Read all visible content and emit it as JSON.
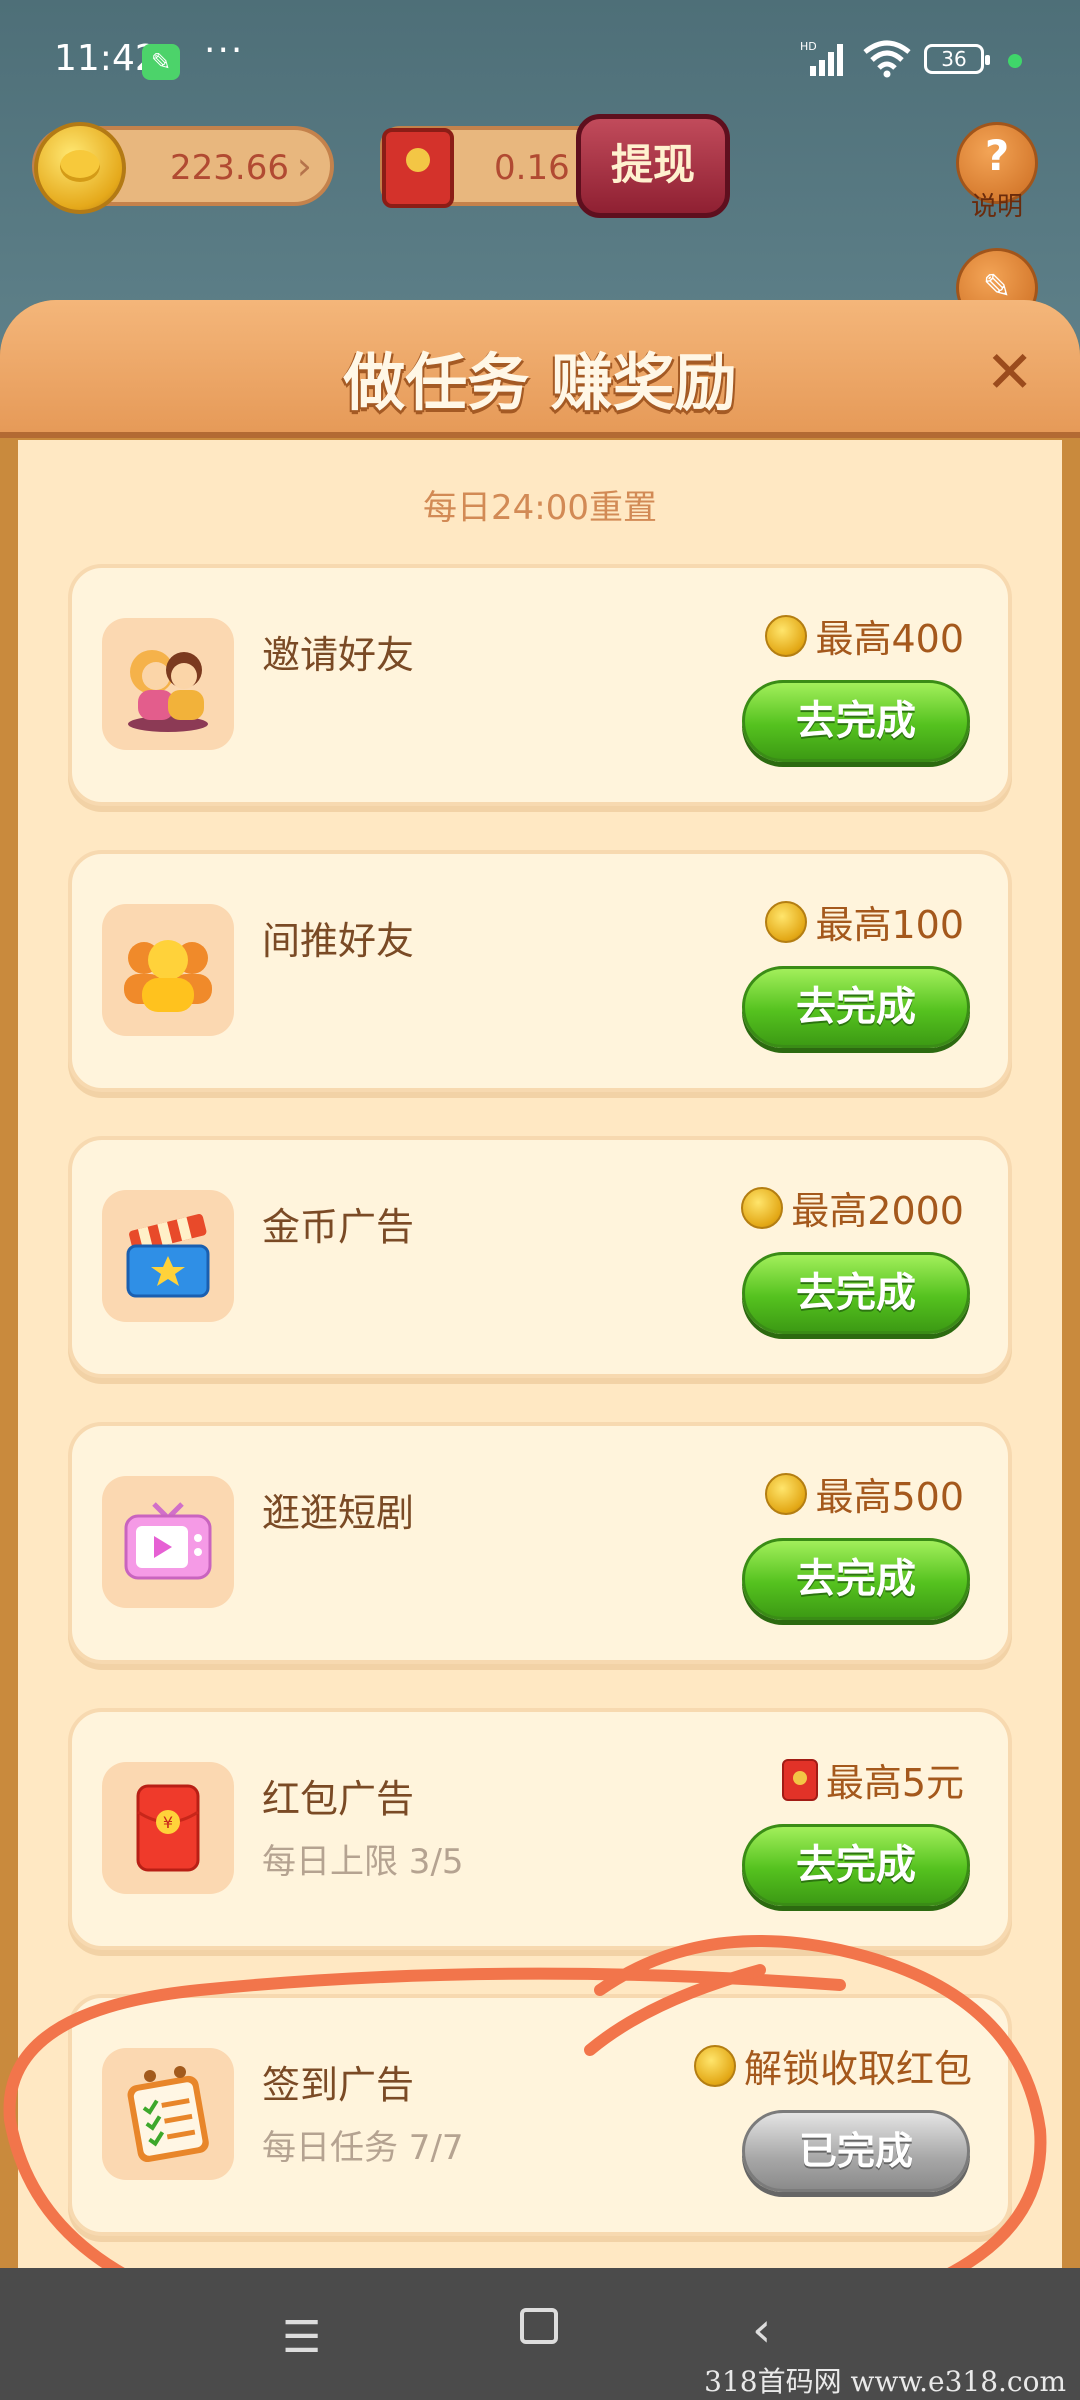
{
  "status_bar": {
    "time": "11:42",
    "more": "···",
    "battery": "36"
  },
  "top_bar": {
    "coins": "223.66",
    "cash": "0.16",
    "withdraw_label": "提现",
    "help_label": "说明"
  },
  "panel": {
    "title": "做任务 赚奖励",
    "reset_note": "每日24:00重置",
    "close": "✕"
  },
  "tasks": [
    {
      "name": "邀请好友",
      "sub": "",
      "reward": "最高400",
      "reward_type": "coin",
      "button": "去完成",
      "icon": "invite-friends-icon"
    },
    {
      "name": "间推好友",
      "sub": "",
      "reward": "最高100",
      "reward_type": "coin",
      "button": "去完成",
      "icon": "indirect-friends-icon"
    },
    {
      "name": "金币广告",
      "sub": "",
      "reward": "最高2000",
      "reward_type": "coin",
      "button": "去完成",
      "icon": "clapperboard-icon"
    },
    {
      "name": "逛逛短剧",
      "sub": "",
      "reward": "最高500",
      "reward_type": "coin",
      "button": "去完成",
      "icon": "tv-play-icon"
    },
    {
      "name": "红包广告",
      "sub": "每日上限 3/5",
      "reward": "最高5元",
      "reward_type": "red-packet",
      "button": "去完成",
      "icon": "red-envelope-icon"
    },
    {
      "name": "签到广告",
      "sub": "每日任务 7/7",
      "reward": "解锁收取红包",
      "reward_type": "coin",
      "button": "已完成",
      "icon": "checklist-icon"
    }
  ],
  "watermark": "318首码网  www.e318.com",
  "colors": {
    "accent_green": "#55c21f",
    "panel_bg": "#ffe8c3",
    "annotation": "#f2754b"
  }
}
